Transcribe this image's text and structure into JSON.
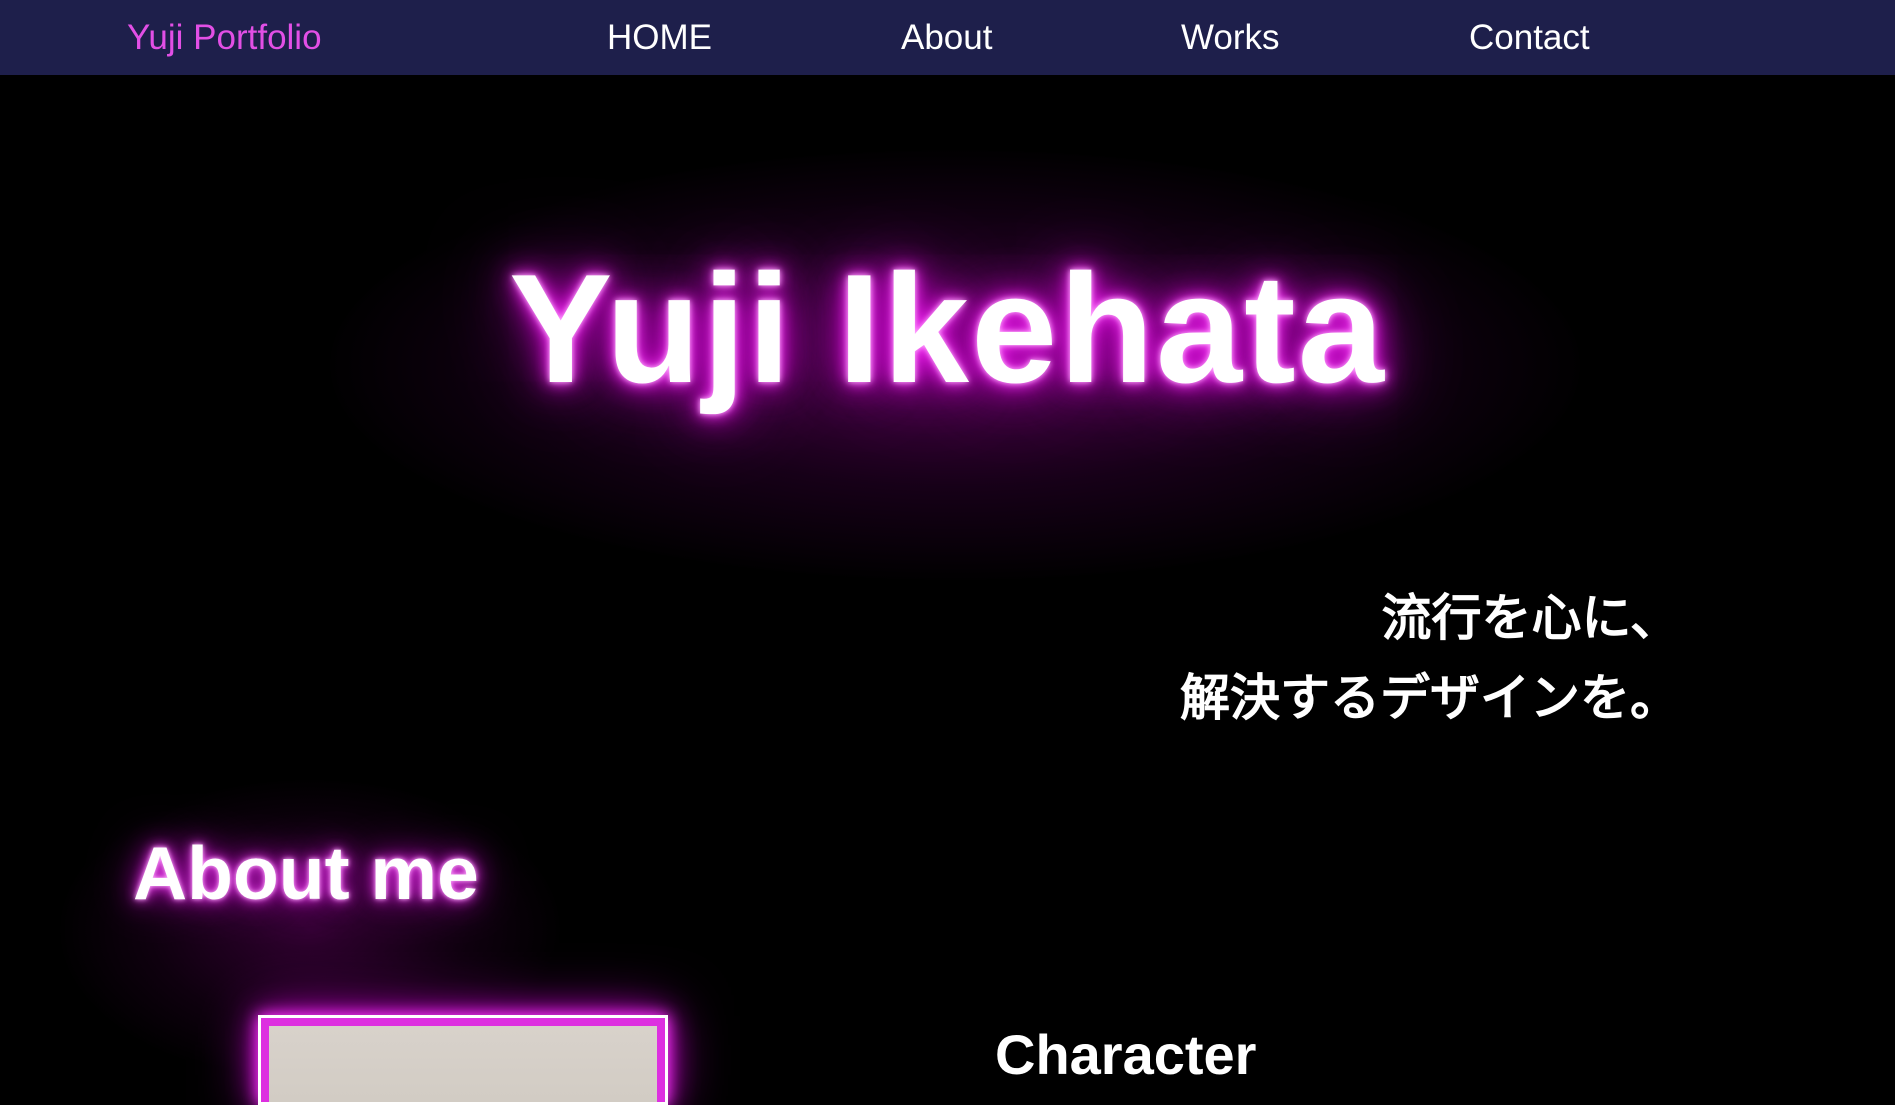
{
  "nav": {
    "brand": "Yuji Portfolio",
    "links": [
      "HOME",
      "About",
      "Works",
      "Contact"
    ]
  },
  "hero": {
    "title": "Yuji Ikehata",
    "tagline_line1": "流行を心に、",
    "tagline_line2": "解決するデザインを。"
  },
  "about": {
    "heading": "About me",
    "character_heading": "Character"
  },
  "colors": {
    "navbar_bg": "#1e1f4b",
    "brand": "#e24fe6",
    "glow": "#ff4cff",
    "page_bg": "#000000"
  }
}
